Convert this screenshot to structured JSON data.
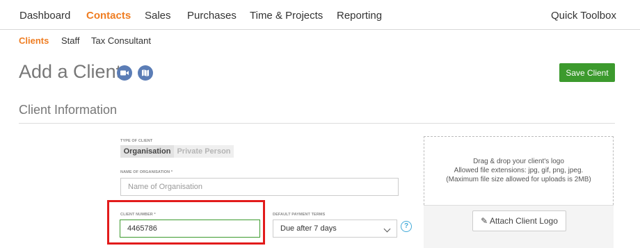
{
  "topnav": {
    "items": [
      "Dashboard",
      "Contacts",
      "Sales",
      "Purchases",
      "Time & Projects",
      "Reporting"
    ],
    "quick_toolbox": "Quick Toolbox"
  },
  "subnav": {
    "items": [
      "Clients",
      "Staff",
      "Tax Consultant"
    ]
  },
  "page": {
    "title": "Add a Client",
    "save_label": "Save Client"
  },
  "section": {
    "title": "Client Information"
  },
  "form": {
    "type_label": "Type of Client",
    "type_options": [
      "Organisation",
      "Private Person"
    ],
    "type_selected": "Organisation",
    "org_label": "Name of Organisation *",
    "org_placeholder": "Name of Organisation",
    "client_number_label": "Client Number *",
    "client_number_value": "4465786",
    "payment_label": "Default Payment Terms",
    "payment_value": "Due after 7 days",
    "help_glyph": "?"
  },
  "logo": {
    "line1": "Drag & drop your client's logo",
    "line2": "Allowed file extensions: jpg, gif, png, jpeg.",
    "line3": "(Maximum file size allowed for uploads is 2MB)",
    "attach_label": "Attach Client Logo"
  },
  "colors": {
    "accent": "#ef7d22",
    "save": "#3c9a2d",
    "highlight": "#e21b1b",
    "icon": "#5b7db6"
  }
}
